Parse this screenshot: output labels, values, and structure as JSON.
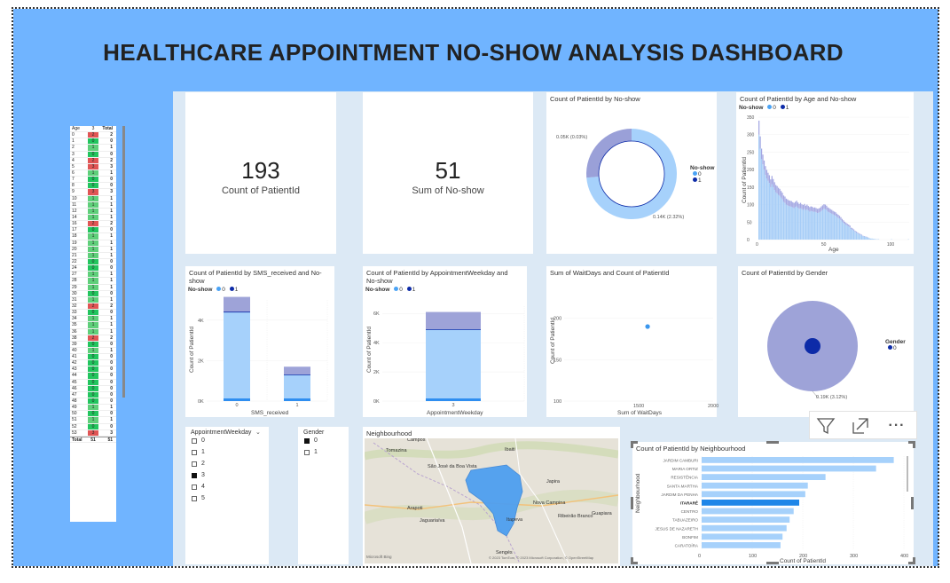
{
  "dashboard": {
    "title": "HEALTHCARE APPOINTMENT NO-SHOW ANALYSIS DASHBOARD",
    "colors": {
      "banner": "#70b4ff",
      "canvas": "#dce9f5",
      "series0": "#a6d1fb",
      "series1": "#0d2ba8",
      "neg": "#e05555",
      "pos": "#22c55e"
    }
  },
  "kpis": [
    {
      "value": "193",
      "label": "Count of PatientId"
    },
    {
      "value": "51",
      "label": "Sum of No-show"
    }
  ],
  "matrix": {
    "headers": [
      "Age",
      "3",
      "Total"
    ],
    "rows": [
      [
        "0",
        "2",
        "2"
      ],
      [
        "1",
        "0",
        "0"
      ],
      [
        "2",
        "1",
        "1"
      ],
      [
        "3",
        "0",
        "0"
      ],
      [
        "4",
        "2",
        "2"
      ],
      [
        "5",
        "3",
        "3"
      ],
      [
        "6",
        "1",
        "1"
      ],
      [
        "7",
        "0",
        "0"
      ],
      [
        "8",
        "0",
        "0"
      ],
      [
        "9",
        "3",
        "3"
      ],
      [
        "10",
        "1",
        "1"
      ],
      [
        "11",
        "1",
        "1"
      ],
      [
        "12",
        "1",
        "1"
      ],
      [
        "14",
        "1",
        "1"
      ],
      [
        "16",
        "2",
        "2"
      ],
      [
        "17",
        "0",
        "0"
      ],
      [
        "18",
        "1",
        "1"
      ],
      [
        "19",
        "1",
        "1"
      ],
      [
        "20",
        "1",
        "1"
      ],
      [
        "21",
        "1",
        "1"
      ],
      [
        "22",
        "0",
        "0"
      ],
      [
        "24",
        "0",
        "0"
      ],
      [
        "27",
        "1",
        "1"
      ],
      [
        "28",
        "1",
        "1"
      ],
      [
        "29",
        "1",
        "1"
      ],
      [
        "30",
        "0",
        "0"
      ],
      [
        "31",
        "1",
        "1"
      ],
      [
        "32",
        "2",
        "2"
      ],
      [
        "33",
        "0",
        "0"
      ],
      [
        "34",
        "1",
        "1"
      ],
      [
        "35",
        "1",
        "1"
      ],
      [
        "36",
        "1",
        "1"
      ],
      [
        "38",
        "2",
        "2"
      ],
      [
        "39",
        "0",
        "0"
      ],
      [
        "40",
        "1",
        "1"
      ],
      [
        "41",
        "0",
        "0"
      ],
      [
        "42",
        "0",
        "0"
      ],
      [
        "43",
        "0",
        "0"
      ],
      [
        "44",
        "0",
        "0"
      ],
      [
        "45",
        "0",
        "0"
      ],
      [
        "46",
        "0",
        "0"
      ],
      [
        "47",
        "0",
        "0"
      ],
      [
        "48",
        "0",
        "0"
      ],
      [
        "49",
        "1",
        "1"
      ],
      [
        "50",
        "0",
        "0"
      ],
      [
        "51",
        "1",
        "1"
      ],
      [
        "52",
        "0",
        "0"
      ],
      [
        "53",
        "3",
        "3"
      ]
    ],
    "total": [
      "Total",
      "51",
      "51"
    ]
  },
  "donut": {
    "title": "Count of PatientId by No-show",
    "legend_title": "No-show",
    "legend": [
      "0",
      "1"
    ],
    "label_small": "0.05K (0.03%)",
    "label_large": "0.14K (2.32%)"
  },
  "age_chart": {
    "title": "Count of PatientId by Age and No-show",
    "legend_title": "No-show",
    "legend": [
      "0",
      "1"
    ],
    "xlabel": "Age",
    "ylabel": "Count of PatientId",
    "yticks": [
      "350",
      "300",
      "250",
      "200",
      "150",
      "100",
      "50",
      "0"
    ],
    "xticks": [
      "0",
      "50",
      "100"
    ]
  },
  "sms_chart": {
    "title": "Count of PatientId by SMS_received and No-show",
    "legend_title": "No-show",
    "legend": [
      "0",
      "1"
    ],
    "xlabel": "SMS_received",
    "ylabel": "Count of PatientId",
    "yticks": [
      "4K",
      "2K",
      "0K"
    ],
    "xticks": [
      "0",
      "1"
    ]
  },
  "weekday_chart": {
    "title": "Count of PatientId by AppointmentWeekday and No-show",
    "legend_title": "No-show",
    "legend": [
      "0",
      "1"
    ],
    "xlabel": "AppointmentWeekday",
    "ylabel": "Count of PatientId",
    "yticks": [
      "6K",
      "4K",
      "2K",
      "0K"
    ],
    "xticks": [
      "3"
    ]
  },
  "scatter_chart": {
    "title": "Sum of WaitDays and Count of PatientId",
    "xlabel": "Sum of WaitDays",
    "ylabel": "Count of PatientId",
    "yticks": [
      "200",
      "150",
      "100"
    ],
    "xticks": [
      "1500",
      "2000"
    ]
  },
  "gender_chart": {
    "title": "Count of PatientId by Gender",
    "legend_title": "Gender",
    "legend": [
      "0"
    ],
    "label": "0.19K (3.12%)"
  },
  "weekday_slicer": {
    "title": "AppointmentWeekday",
    "items": [
      "0",
      "1",
      "2",
      "3",
      "4",
      "5"
    ],
    "selected": "3"
  },
  "gender_slicer": {
    "title": "Gender",
    "items": [
      "0",
      "1"
    ],
    "selected": "0"
  },
  "map": {
    "title": "Neighbourhood",
    "labels": [
      "Campos",
      "Tomazina",
      "São José da Boa Vista",
      "Ibaiti",
      "Japira",
      "Arapoti",
      "Nova Campina",
      "Ribeirão Branco",
      "Guapiara",
      "Jaguariaíva",
      "Itapeva",
      "Sengés"
    ],
    "attribution": "© 2023 TomTom, © 2023 Microsoft Corporation, © OpenStreetMap",
    "brand": "Microsoft Bing"
  },
  "neighbourhood_chart": {
    "title": "Count of PatientId by Neighbourhood",
    "xlabel": "Count of PatientId",
    "ylabel": "Neighbourhood",
    "xticks": [
      "0",
      "100",
      "200",
      "300",
      "400"
    ]
  },
  "toolbar": {
    "icons": [
      "filter-icon",
      "focus-mode-icon",
      "more-options-icon"
    ],
    "more_label": "···"
  },
  "chart_data": [
    {
      "type": "pie",
      "title": "Count of PatientId by No-show",
      "categories": [
        "0",
        "1"
      ],
      "values": [
        140,
        50
      ]
    },
    {
      "type": "bar",
      "title": "Count of PatientId by SMS_received and No-show",
      "categories": [
        "0",
        "1"
      ],
      "series": [
        {
          "name": "0",
          "values": [
            4400,
            1300
          ]
        },
        {
          "name": "1",
          "values": [
            750,
            400
          ]
        }
      ],
      "ylim": [
        0,
        5000
      ]
    },
    {
      "type": "bar",
      "title": "Count of PatientId by AppointmentWeekday and No-show",
      "categories": [
        "3"
      ],
      "series": [
        {
          "name": "0",
          "values": [
            4900
          ]
        },
        {
          "name": "1",
          "values": [
            1200
          ]
        }
      ],
      "ylim": [
        0,
        6500
      ]
    },
    {
      "type": "scatter",
      "title": "Sum of WaitDays and Count of PatientId",
      "points": [
        {
          "x": 1560,
          "y": 190
        }
      ],
      "xlim": [
        1000,
        2000
      ],
      "ylim": [
        100,
        220
      ]
    },
    {
      "type": "pie",
      "title": "Count of PatientId by Gender",
      "categories": [
        "0"
      ],
      "values": [
        190
      ]
    },
    {
      "type": "bar",
      "title": "Count of PatientId by Neighbourhood",
      "orientation": "horizontal",
      "categories": [
        "JARDIM CAMBURI",
        "MARIA ORTIZ",
        "RESISTÊNCIA",
        "SANTA MARTHA",
        "JARDIM DA PENHA",
        "ITARARÉ",
        "CENTRO",
        "TABUAZEIRO",
        "JESUS DE NAZARETH",
        "BONFIM",
        "CARATOÍRA"
      ],
      "values": [
        380,
        345,
        245,
        210,
        205,
        193,
        182,
        174,
        168,
        160,
        156
      ],
      "highlight": "ITARARÉ",
      "xlim": [
        0,
        400
      ]
    },
    {
      "type": "bar",
      "title": "Count of PatientId by Age and No-show",
      "xlim": [
        0,
        115
      ],
      "ylim": [
        0,
        350
      ],
      "categories": [
        "0",
        "1",
        "2",
        "3",
        "4",
        "5",
        "6",
        "7",
        "8",
        "9",
        "10",
        "11",
        "12",
        "13",
        "14",
        "15",
        "16",
        "17",
        "18",
        "19",
        "20",
        "21",
        "22",
        "23",
        "24",
        "25",
        "26",
        "27",
        "28",
        "29",
        "30",
        "31",
        "32",
        "33",
        "34",
        "35",
        "36",
        "37",
        "38",
        "39",
        "40",
        "41",
        "42",
        "43",
        "44",
        "45",
        "46",
        "47",
        "48",
        "49",
        "50",
        "51",
        "52",
        "53",
        "54",
        "55",
        "56",
        "57",
        "58",
        "59",
        "60",
        "61",
        "62",
        "63",
        "64",
        "65",
        "66",
        "67",
        "68",
        "69",
        "70",
        "71",
        "72",
        "73",
        "74",
        "75",
        "76",
        "77",
        "78",
        "79",
        "80",
        "81",
        "82",
        "83",
        "84",
        "85",
        "86",
        "87",
        "88",
        "89",
        "90",
        "91",
        "92",
        "93",
        "94",
        "95",
        "96",
        "97",
        "98",
        "99",
        "100",
        "101",
        "102",
        "103",
        "104",
        "105",
        "106",
        "107",
        "108",
        "109",
        "110",
        "111",
        "112",
        "113",
        "114",
        "115"
      ],
      "series": [
        {
          "name": "0",
          "values": [
            300,
            260,
            230,
            215,
            200,
            185,
            175,
            168,
            162,
            150,
            158,
            150,
            142,
            135,
            132,
            128,
            125,
            120,
            115,
            108,
            105,
            100,
            98,
            96,
            95,
            94,
            92,
            90,
            93,
            95,
            91,
            88,
            90,
            87,
            85,
            88,
            84,
            86,
            83,
            80,
            82,
            81,
            79,
            80,
            78,
            76,
            77,
            79,
            82,
            85,
            88,
            87,
            85,
            80,
            78,
            76,
            74,
            72,
            70,
            68,
            65,
            62,
            60,
            56,
            52,
            48,
            45,
            42,
            40,
            38,
            35,
            30,
            28,
            26,
            22,
            20,
            18,
            16,
            14,
            12,
            10,
            9,
            8,
            7,
            5,
            4,
            3,
            3,
            2,
            2,
            1,
            1,
            1,
            0,
            0,
            0,
            0,
            0,
            0,
            0,
            0,
            0,
            1,
            0,
            0,
            0,
            0,
            0,
            0,
            0,
            0,
            0,
            0,
            0,
            0,
            1
          ]
        },
        {
          "name": "1",
          "values": [
            40,
            35,
            30,
            28,
            26,
            25,
            24,
            23,
            22,
            22,
            24,
            23,
            22,
            21,
            21,
            20,
            20,
            19,
            19,
            18,
            18,
            17,
            17,
            16,
            16,
            16,
            15,
            15,
            15,
            16,
            15,
            14,
            15,
            14,
            14,
            14,
            13,
            14,
            13,
            13,
            13,
            13,
            12,
            12,
            12,
            12,
            12,
            12,
            13,
            13,
            13,
            13,
            12,
            12,
            12,
            11,
            11,
            10,
            10,
            10,
            9,
            9,
            8,
            8,
            7,
            7,
            6,
            6,
            5,
            5,
            5,
            4,
            4,
            3,
            3,
            3,
            2,
            2,
            2,
            2,
            1,
            1,
            1,
            1,
            1,
            0,
            0,
            0,
            0,
            0,
            0,
            0,
            0,
            0,
            0,
            0,
            0,
            0,
            0,
            0,
            0,
            0,
            0,
            0,
            0,
            0,
            0,
            0,
            0,
            0,
            0,
            0,
            0,
            0,
            0,
            0
          ]
        }
      ]
    }
  ]
}
